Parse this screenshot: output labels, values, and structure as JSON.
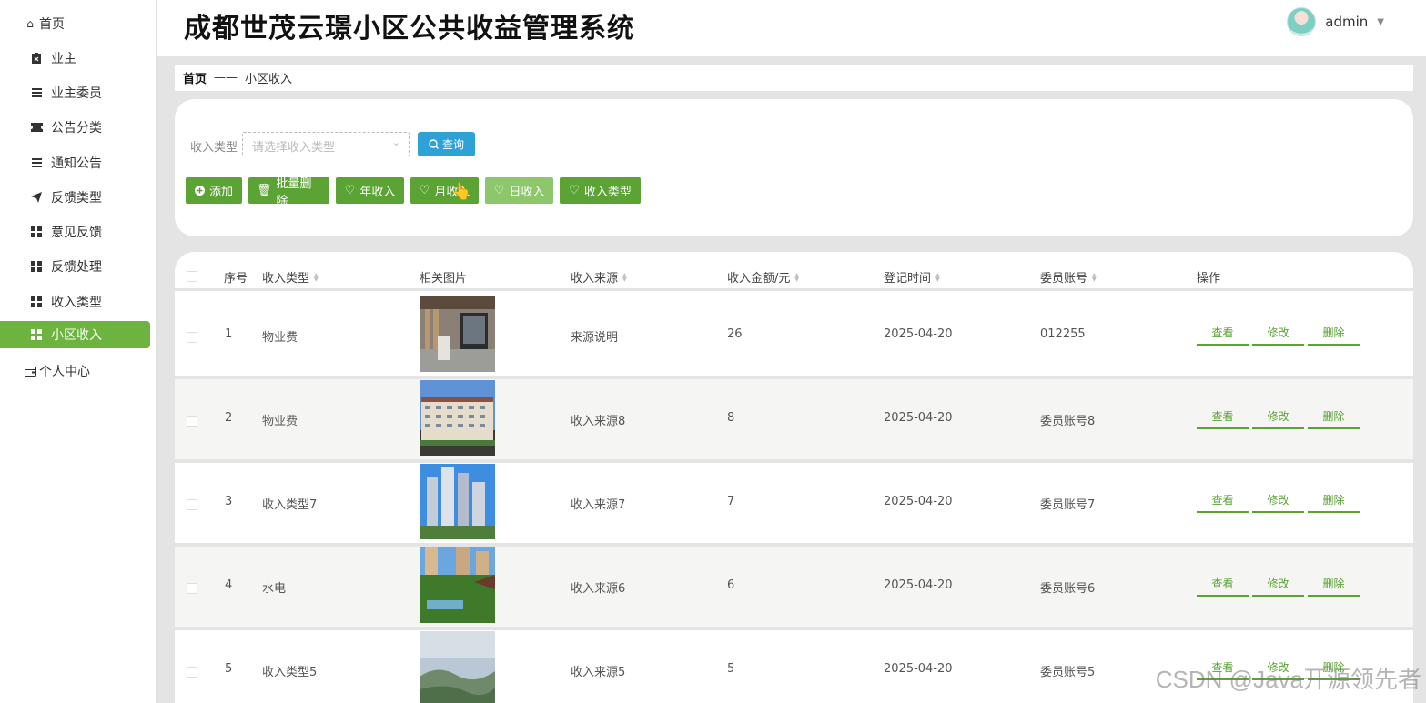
{
  "sidebar": {
    "items": [
      {
        "label": "首页",
        "icon": "home-icon"
      },
      {
        "label": "业主",
        "icon": "clipboard-icon"
      },
      {
        "label": "业主委员",
        "icon": "list-icon"
      },
      {
        "label": "公告分类",
        "icon": "ticket-icon"
      },
      {
        "label": "通知公告",
        "icon": "menu-icon"
      },
      {
        "label": "反馈类型",
        "icon": "send-icon"
      },
      {
        "label": "意见反馈",
        "icon": "grid-icon"
      },
      {
        "label": "反馈处理",
        "icon": "grid-icon"
      },
      {
        "label": "收入类型",
        "icon": "grid-icon"
      },
      {
        "label": "小区收入",
        "icon": "grid-icon"
      },
      {
        "label": "个人中心",
        "icon": "wallet-icon"
      }
    ],
    "active_color": "#6db33f"
  },
  "header": {
    "title": "成都世茂云璟小区公共收益管理系统",
    "username": "admin"
  },
  "breadcrumb": {
    "home": "首页",
    "separator": "——",
    "current": "小区收入"
  },
  "search": {
    "label": "收入类型",
    "placeholder": "请选择收入类型",
    "query_button": "查询"
  },
  "actions": {
    "add": "添加",
    "batch_delete": "批量删除",
    "year_income": "年收入",
    "month_income": "月收入",
    "day_income": "日收入",
    "income_type": "收入类型"
  },
  "table": {
    "headers": {
      "index": "序号",
      "type": "收入类型",
      "image": "相关图片",
      "source": "收入来源",
      "amount": "收入金额/元",
      "date": "登记时间",
      "account": "委员账号",
      "ops": "操作"
    },
    "op_labels": {
      "view": "查看",
      "edit": "修改",
      "delete": "删除"
    },
    "rows": [
      {
        "index": "1",
        "type": "物业费",
        "source": "来源说明",
        "amount": "26",
        "date": "2025-04-20",
        "account": "012255"
      },
      {
        "index": "2",
        "type": "物业费",
        "source": "收入来源8",
        "amount": "8",
        "date": "2025-04-20",
        "account": "委员账号8"
      },
      {
        "index": "3",
        "type": "收入类型7",
        "source": "收入来源7",
        "amount": "7",
        "date": "2025-04-20",
        "account": "委员账号7"
      },
      {
        "index": "4",
        "type": "水电",
        "source": "收入来源6",
        "amount": "6",
        "date": "2025-04-20",
        "account": "委员账号6"
      },
      {
        "index": "5",
        "type": "收入类型5",
        "source": "收入来源5",
        "amount": "5",
        "date": "2025-04-20",
        "account": "委员账号5"
      }
    ]
  },
  "watermark": "CSDN @Java开源领先者"
}
